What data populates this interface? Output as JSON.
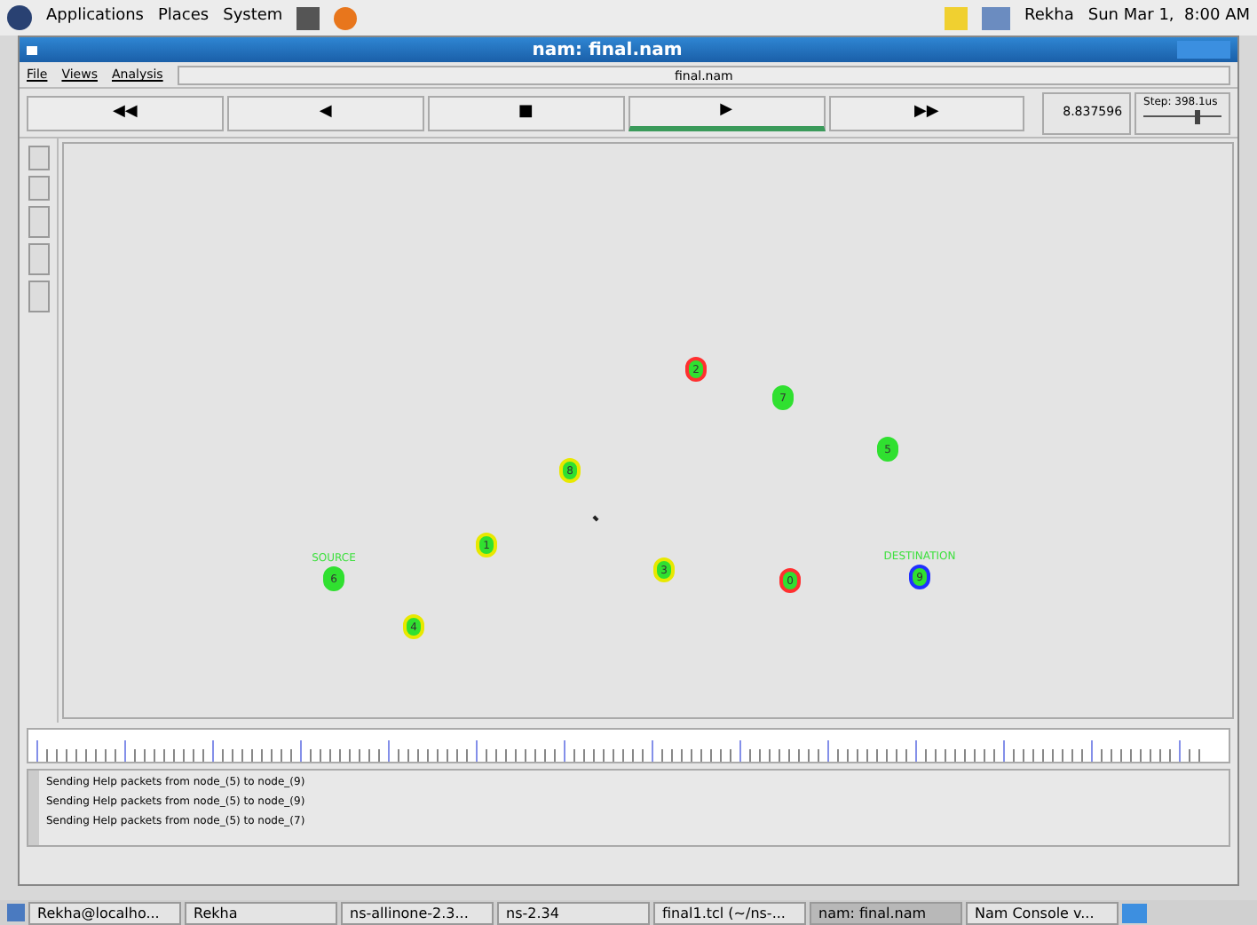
{
  "top_panel": {
    "menus": [
      "Applications",
      "Places",
      "System"
    ],
    "user": "Rekha",
    "clock": "Sun Mar 1,  8:00 AM"
  },
  "window": {
    "title": "nam: final.nam"
  },
  "menu_bar": [
    "File",
    "Views",
    "Analysis"
  ],
  "file_label": "final.nam",
  "controls": [
    {
      "symbol": "◀◀",
      "selected": false
    },
    {
      "symbol": "◀",
      "selected": false
    },
    {
      "symbol": "■",
      "selected": false
    },
    {
      "symbol": "▶",
      "selected": true
    },
    {
      "symbol": "▶▶",
      "selected": false
    }
  ],
  "time": "8.837596",
  "step": {
    "label": "Step: 398.1us",
    "level": 0.7
  },
  "nodes": [
    {
      "label": "2",
      "color": "#ff3030"
    },
    {
      "label": "7",
      "color": "#30e030"
    },
    {
      "label": "5",
      "color": "#30e030"
    },
    {
      "label": "8",
      "color": "#e8e800"
    },
    {
      "label": "1",
      "color": "#e8e800"
    },
    {
      "label": "6",
      "color": "#30e030",
      "caption": "SOURCE"
    },
    {
      "label": "3",
      "color": "#e8e800"
    },
    {
      "label": "0",
      "color": "#ff3030"
    },
    {
      "label": "9",
      "color": "#2030ff",
      "caption": "DESTINATION"
    },
    {
      "label": "4",
      "color": "#e8e800"
    }
  ],
  "log": [
    "Sending Help packets from node_(5) to node_(9)",
    "Sending Help packets from node_(5) to node_(9)",
    "Sending Help packets from node_(5) to node_(7)"
  ],
  "taskbar": [
    {
      "label": "Rekha@localho...",
      "selected": false
    },
    {
      "label": "Rekha",
      "selected": false
    },
    {
      "label": "ns-allinone-2.3...",
      "selected": false
    },
    {
      "label": "ns-2.34",
      "selected": false
    },
    {
      "label": "final1.tcl (~/ns-...",
      "selected": false
    },
    {
      "label": "nam: final.nam",
      "selected": true
    },
    {
      "label": "Nam Console v...",
      "selected": false
    }
  ]
}
